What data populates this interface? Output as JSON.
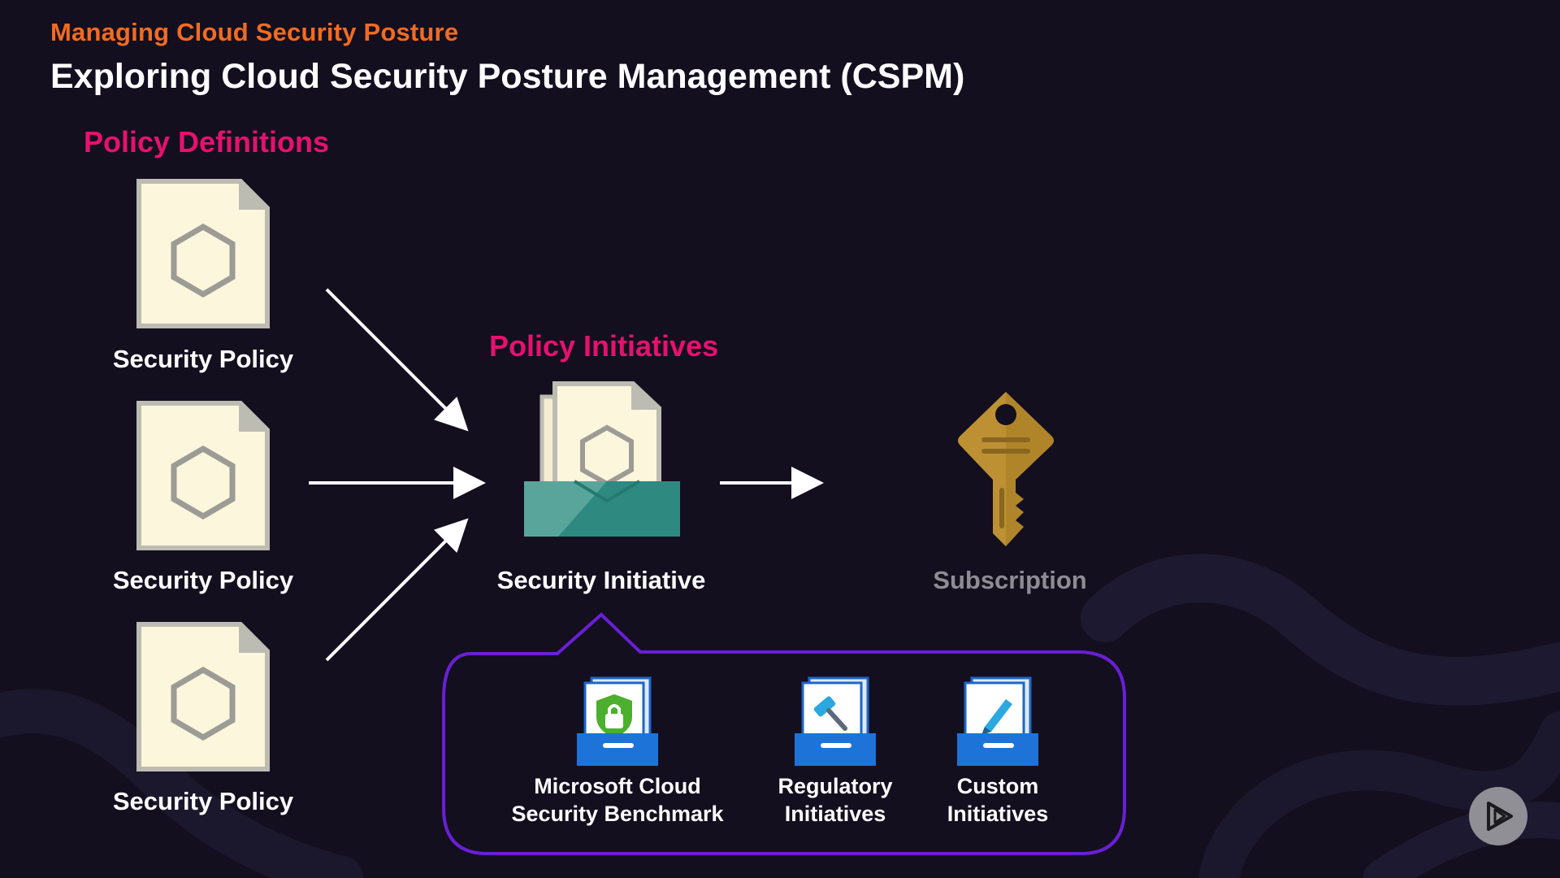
{
  "header": {
    "eyebrow": "Managing Cloud Security Posture",
    "title": "Exploring Cloud Security Posture Management (CSPM)"
  },
  "diagram": {
    "definitions_heading": "Policy Definitions",
    "policies": [
      {
        "label": "Security Policy",
        "icon": "policy-document-icon"
      },
      {
        "label": "Security Policy",
        "icon": "policy-document-icon"
      },
      {
        "label": "Security Policy",
        "icon": "policy-document-icon"
      }
    ],
    "initiatives_heading": "Policy Initiatives",
    "initiative": {
      "label": "Security Initiative",
      "icon": "initiative-inbox-icon"
    },
    "subscription": {
      "label": "Subscription",
      "icon": "key-icon"
    },
    "initiative_types": [
      {
        "line1": "Microsoft Cloud",
        "line2": "Security Benchmark",
        "icon": "shield-lock-icon"
      },
      {
        "line1": "Regulatory",
        "line2": "Initiatives",
        "icon": "gavel-icon"
      },
      {
        "line1": "Custom",
        "line2": "Initiatives",
        "icon": "pencil-icon"
      }
    ]
  },
  "colors": {
    "background": "#130f1f",
    "eyebrow": "#f26b21",
    "heading": "#e6116f",
    "callout_border": "#6a1fd6",
    "document_fill": "#fbf6dc",
    "document_border": "#bdbcb3",
    "key": "#b0852a",
    "inbox_teal": "#2e8a80"
  }
}
